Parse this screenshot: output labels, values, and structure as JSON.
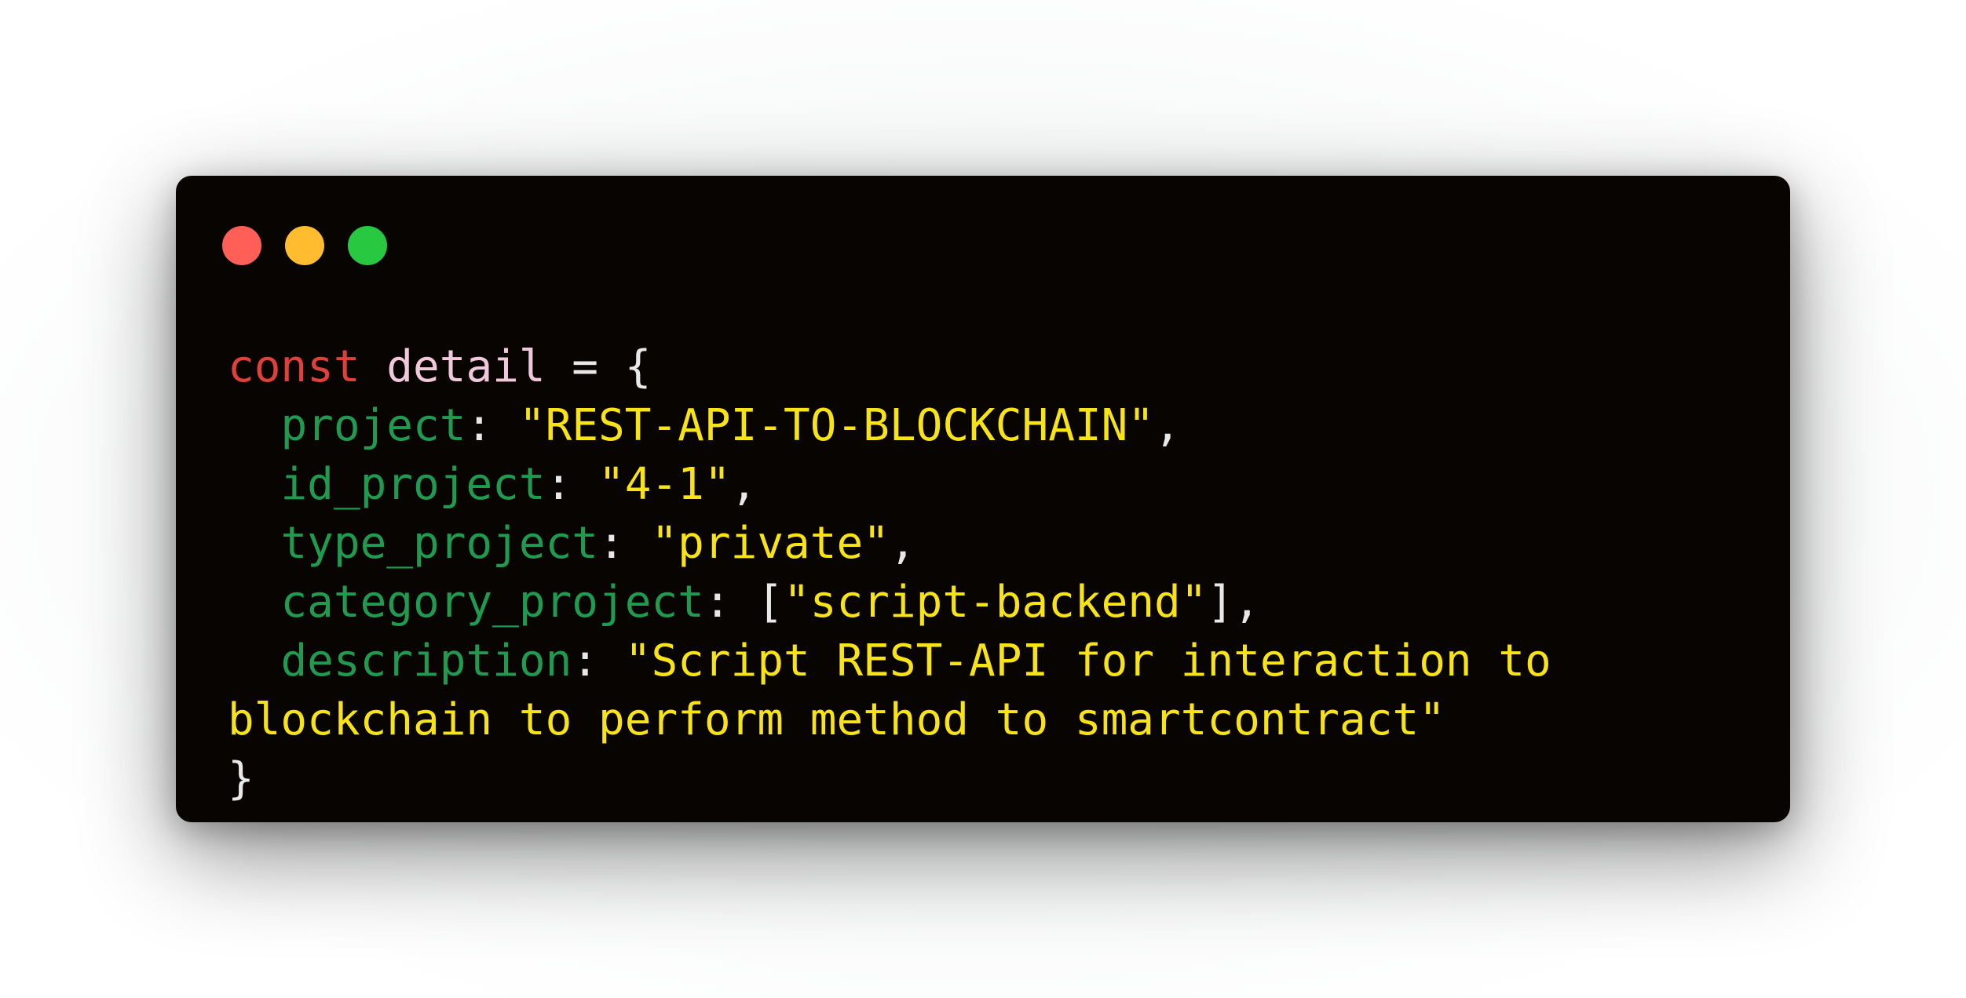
{
  "window": {
    "controls": {
      "close": "red-traffic-light",
      "minimize": "yellow-traffic-light",
      "maximize": "green-traffic-light"
    }
  },
  "colors": {
    "background": "#070402",
    "keyword": "#e0403a",
    "variable": "#f0c8dc",
    "property": "#1f9a4e",
    "string": "#f7e316",
    "punctuation": "#e8e8e8"
  },
  "code": {
    "line1": {
      "keyword": "const",
      "variable": "detail",
      "operator": " = {"
    },
    "line2": {
      "key": "project",
      "sep": ": ",
      "value": "\"REST-API-TO-BLOCKCHAIN\"",
      "end": ","
    },
    "line3": {
      "key": "id_project",
      "sep": ": ",
      "value": "\"4-1\"",
      "end": ","
    },
    "line4": {
      "key": "type_project",
      "sep": ": ",
      "value": "\"private\"",
      "end": ","
    },
    "line5": {
      "key": "category_project",
      "sep": ": [",
      "value": "\"script-backend\"",
      "end": "],"
    },
    "line6": {
      "key": "description",
      "sep": ": ",
      "value": "\"Script REST-API for interaction to"
    },
    "line7": {
      "value": "blockchain to perform method to smartcontract\""
    },
    "line8": {
      "close": "}"
    }
  }
}
